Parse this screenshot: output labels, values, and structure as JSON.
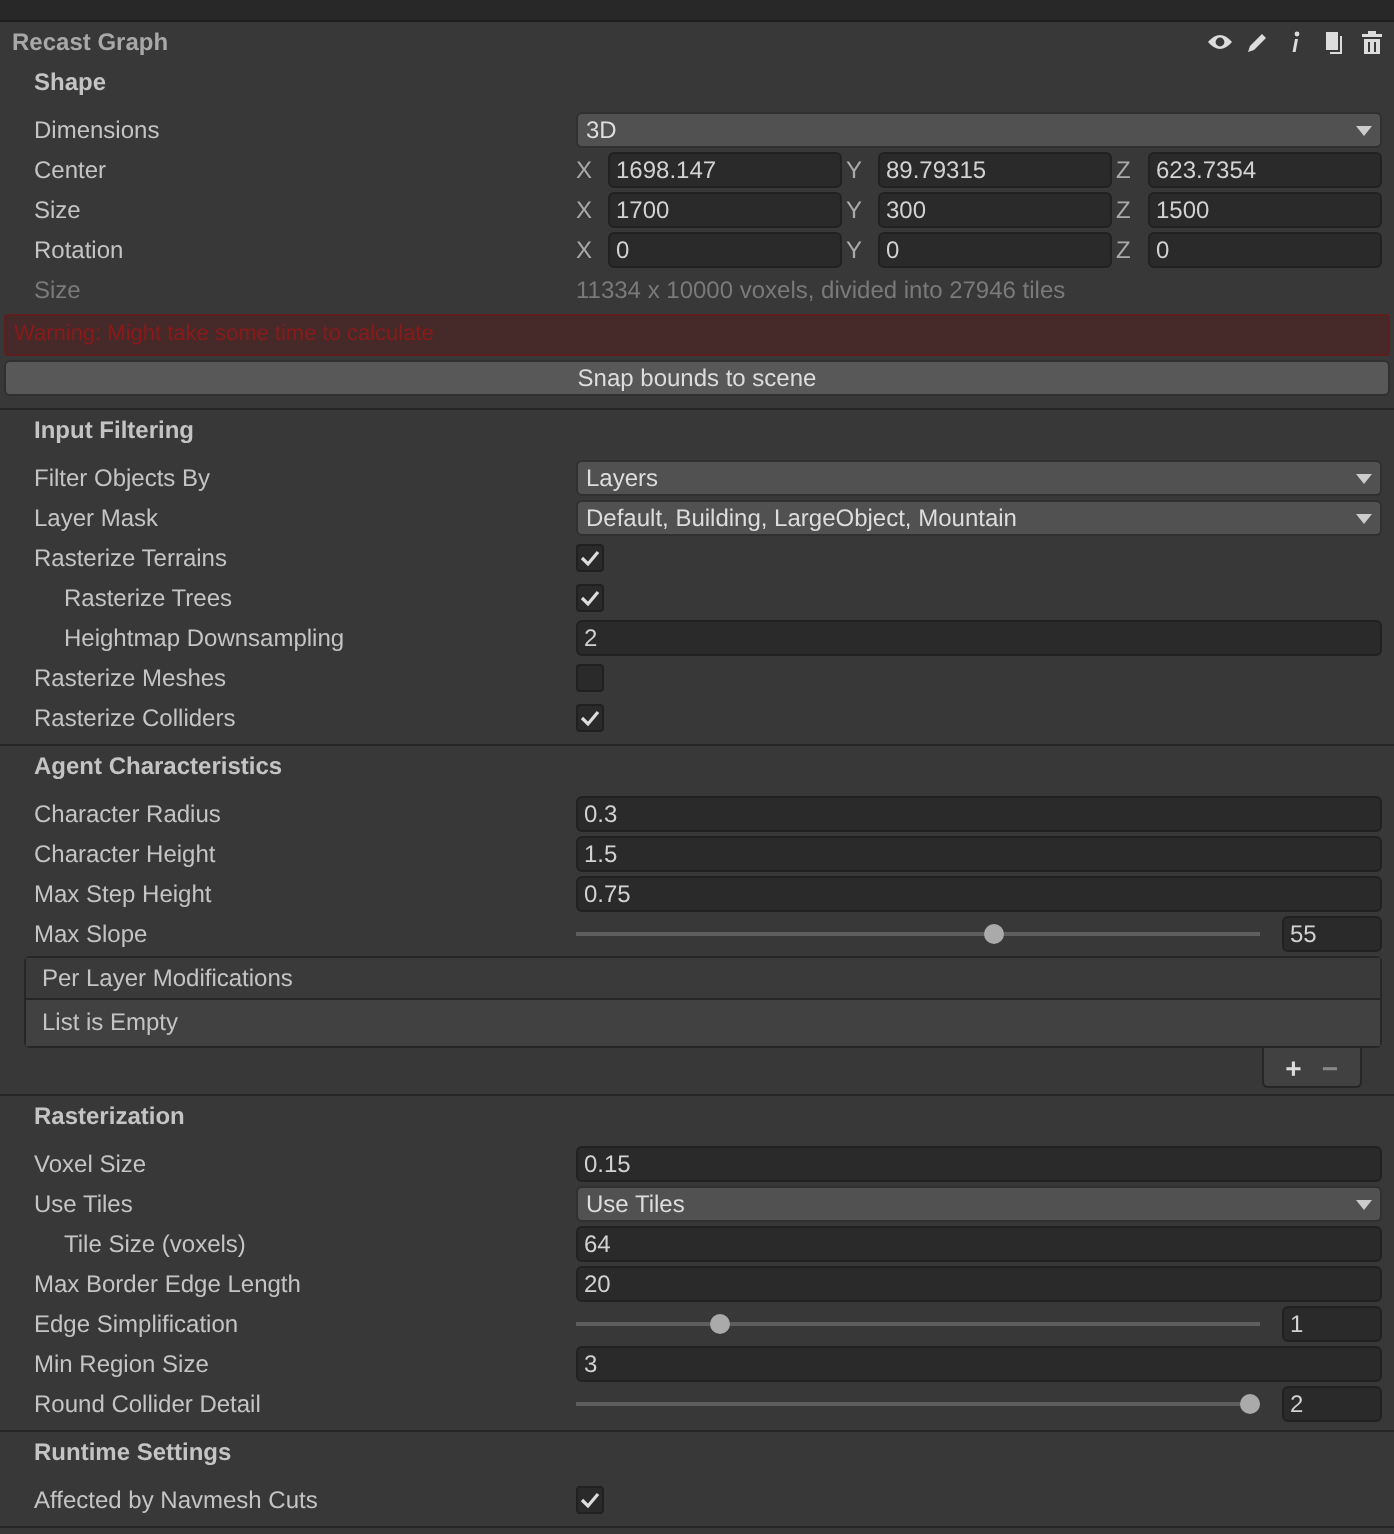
{
  "panel": {
    "title": "Recast Graph"
  },
  "sections": [
    {
      "title": "Shape",
      "rows": [
        {
          "kind": "dropdown",
          "label": "Dimensions",
          "value": "3D"
        },
        {
          "kind": "vector",
          "label": "Center",
          "axes": [
            {
              "axis": "X",
              "value": "1698.147"
            },
            {
              "axis": "Y",
              "value": "89.79315"
            },
            {
              "axis": "Z",
              "value": "623.7354"
            }
          ]
        },
        {
          "kind": "vector",
          "label": "Size",
          "axes": [
            {
              "axis": "X",
              "value": "1700"
            },
            {
              "axis": "Y",
              "value": "300"
            },
            {
              "axis": "Z",
              "value": "1500"
            }
          ]
        },
        {
          "kind": "vector",
          "label": "Rotation",
          "axes": [
            {
              "axis": "X",
              "value": "0"
            },
            {
              "axis": "Y",
              "value": "0"
            },
            {
              "axis": "Z",
              "value": "0"
            }
          ]
        },
        {
          "kind": "info",
          "label": "Size",
          "value": "11334 x 10000 voxels, divided into 27946 tiles"
        },
        {
          "kind": "warning",
          "value": "Warning: Might take some time to calculate"
        },
        {
          "kind": "button",
          "value": "Snap bounds to scene"
        }
      ]
    },
    {
      "title": "Input Filtering",
      "rows": [
        {
          "kind": "dropdown",
          "label": "Filter Objects By",
          "value": "Layers"
        },
        {
          "kind": "dropdown",
          "label": "Layer Mask",
          "value": "Default, Building, LargeObject, Mountain"
        },
        {
          "kind": "checkbox",
          "label": "Rasterize Terrains",
          "checked": true,
          "children": [
            {
              "kind": "checkbox",
              "label": "Rasterize Trees",
              "checked": true
            },
            {
              "kind": "field",
              "label": "Heightmap Downsampling",
              "value": "2"
            }
          ]
        },
        {
          "kind": "checkbox",
          "label": "Rasterize Meshes",
          "checked": false
        },
        {
          "kind": "checkbox",
          "label": "Rasterize Colliders",
          "checked": true
        }
      ]
    },
    {
      "title": "Agent Characteristics",
      "rows": [
        {
          "kind": "field",
          "label": "Character Radius",
          "value": "0.3"
        },
        {
          "kind": "field",
          "label": "Character Height",
          "value": "1.5"
        },
        {
          "kind": "field",
          "label": "Max Step Height",
          "value": "0.75"
        },
        {
          "kind": "slider",
          "label": "Max Slope",
          "level": 0.61,
          "value": "55"
        },
        {
          "kind": "list",
          "label": "Per Layer Modifications",
          "value": "List is Empty",
          "buttons": [
            "+",
            "−"
          ]
        }
      ]
    },
    {
      "title": "Rasterization",
      "rows": [
        {
          "kind": "field",
          "label": "Voxel Size",
          "value": "0.15"
        },
        {
          "kind": "dropdown",
          "label": "Use Tiles",
          "value": "Use Tiles",
          "children": [
            {
              "kind": "field",
              "label": "Tile Size (voxels)",
              "value": "64"
            }
          ]
        },
        {
          "kind": "field",
          "label": "Max Border Edge Length",
          "value": "20"
        },
        {
          "kind": "slider",
          "label": "Edge Simplification",
          "level": 0.21,
          "value": "1"
        },
        {
          "kind": "field",
          "label": "Min Region Size",
          "value": "3"
        },
        {
          "kind": "slider",
          "label": "Round Collider Detail",
          "level": 0.985,
          "value": "2"
        }
      ]
    },
    {
      "title": "Runtime Settings",
      "rows": [
        {
          "kind": "checkbox",
          "label": "Affected by Navmesh Cuts",
          "checked": true
        }
      ]
    }
  ]
}
